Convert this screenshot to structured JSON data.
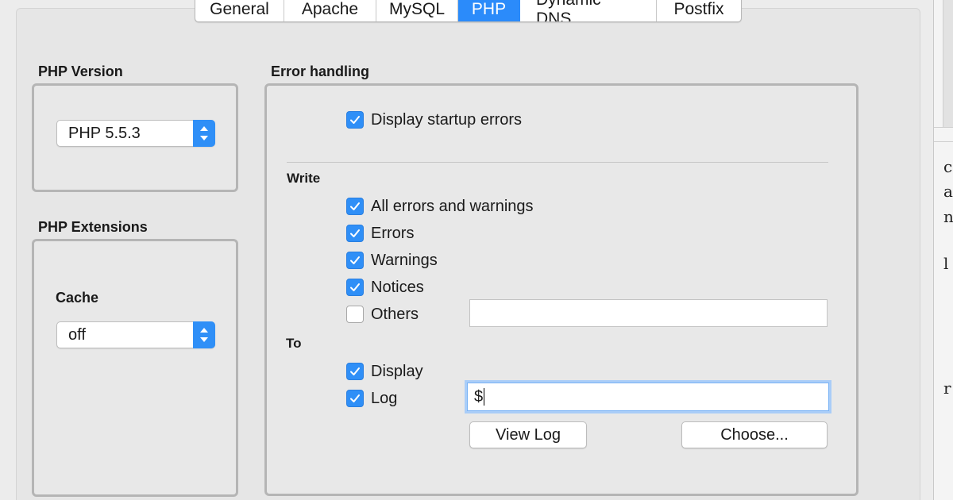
{
  "tabs": [
    {
      "label": "General",
      "active": false
    },
    {
      "label": "Apache",
      "active": false
    },
    {
      "label": "MySQL",
      "active": false
    },
    {
      "label": "PHP",
      "active": true
    },
    {
      "label": "Dynamic DNS",
      "active": false
    },
    {
      "label": "Postfix",
      "active": false
    }
  ],
  "php_version": {
    "title": "PHP Version",
    "selected": "PHP 5.5.3"
  },
  "php_extensions": {
    "title": "PHP Extensions",
    "cache_label": "Cache",
    "cache_selected": "off"
  },
  "error_handling": {
    "title": "Error handling",
    "display_startup_errors": {
      "label": "Display startup errors",
      "checked": true
    },
    "write_title": "Write",
    "write_options": [
      {
        "label": "All errors and warnings",
        "checked": true
      },
      {
        "label": "Errors",
        "checked": true
      },
      {
        "label": "Warnings",
        "checked": true
      },
      {
        "label": "Notices",
        "checked": true
      },
      {
        "label": "Others",
        "checked": false
      }
    ],
    "others_value": "",
    "to_title": "To",
    "to_options": [
      {
        "label": "Display",
        "checked": true
      },
      {
        "label": "Log",
        "checked": true
      }
    ],
    "log_path_value": "$",
    "view_log_button": "View Log",
    "choose_button": "Choose..."
  },
  "colors": {
    "accent": "#2f8ff7",
    "tab_active": "#2b8bfa",
    "panel_bg": "#e6e6e6"
  },
  "edge_window": {
    "text_lines": [
      "c",
      "a",
      "n",
      "l",
      "r"
    ]
  }
}
